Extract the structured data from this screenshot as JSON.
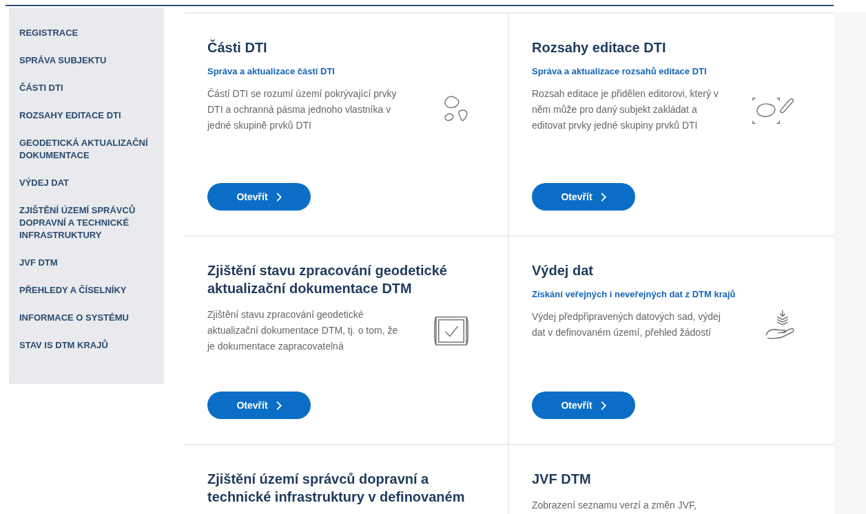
{
  "sidebar": {
    "items": [
      {
        "label": "REGISTRACE"
      },
      {
        "label": "SPRÁVA SUBJEKTU"
      },
      {
        "label": "ČÁSTI DTI"
      },
      {
        "label": "ROZSAHY EDITACE DTI"
      },
      {
        "label": "GEODETICKÁ AKTUALIZAČNÍ DOKUMENTACE"
      },
      {
        "label": "VÝDEJ DAT"
      },
      {
        "label": "ZJIŠTĚNÍ ÚZEMÍ SPRÁVCŮ DOPRAVNÍ A TECHNICKÉ INFRASTRUKTURY"
      },
      {
        "label": "JVF DTM"
      },
      {
        "label": "PŘEHLEDY A ČÍSELNÍKY"
      },
      {
        "label": "INFORMACE O SYSTÉMU"
      },
      {
        "label": "STAV IS DTM KRAJŮ"
      }
    ]
  },
  "cards": [
    {
      "title": "Části DTI",
      "subtitle": "Správa a aktualizace částí DTI",
      "description": "Částí DTI se rozumí území pokrývající prvky DTI a ochranná pásma jednoho vlastníka v jedné skupině prvků DTI",
      "button": "Otevřít"
    },
    {
      "title": "Rozsahy editace DTI",
      "subtitle": "Správa a aktualizace rozsahů editace DTI",
      "description": "Rozsah editace je přidělen editorovi, který v něm může pro daný subjekt zakládat a editovat prvky jedné skupiny prvků DTI",
      "button": "Otevřít"
    },
    {
      "title": "Zjištění stavu zpracování geodetické aktualizační dokumentace DTM",
      "description": "Zjištění stavu zpracování geodetické aktualizační dokumentace DTM, tj. o tom, že je dokumentace zapracovatelná",
      "button": "Otevřít"
    },
    {
      "title": "Výdej dat",
      "subtitle": "Získání veřejných i neveřejných dat z DTM krajů",
      "description": "Výdej předpřipravených datových sad, výdej dat v definovaném území, přehled žádostí",
      "button": "Otevřít"
    },
    {
      "title": "Zjištění území správců dopravní a technické infrastruktury v definovaném"
    },
    {
      "title": "JVF DTM",
      "description": "Zobrazení seznamu verzí a změn JVF,"
    }
  ]
}
